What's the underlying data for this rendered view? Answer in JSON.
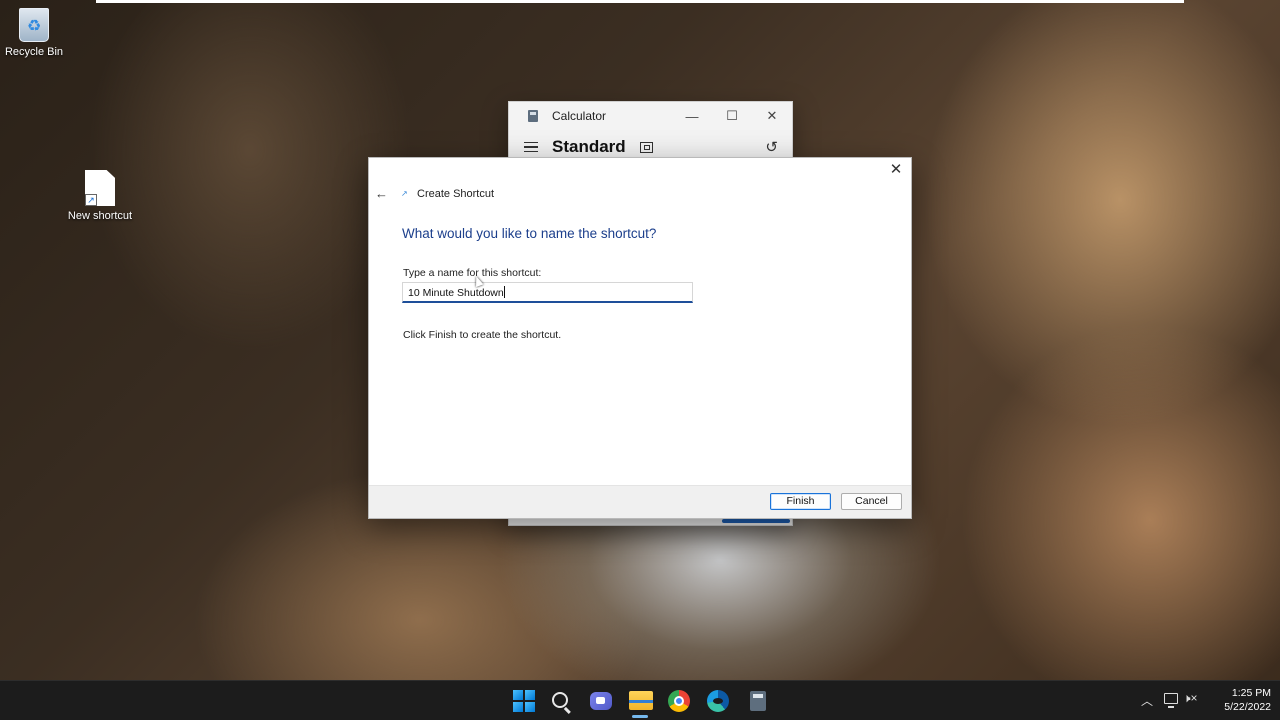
{
  "desktop": {
    "recycle_bin_label": "Recycle Bin",
    "new_shortcut_label": "New shortcut"
  },
  "calculator": {
    "title": "Calculator",
    "mode": "Standard",
    "minimize_glyph": "—",
    "maximize_glyph": "☐",
    "close_glyph": "✕"
  },
  "dialog": {
    "title": "Create Shortcut",
    "question": "What would you like to name the shortcut?",
    "name_label": "Type a name for this shortcut:",
    "name_value": "10 Minute Shutdown",
    "hint": "Click Finish to create the shortcut.",
    "finish_label": "Finish",
    "cancel_label": "Cancel",
    "close_glyph": "✕",
    "back_glyph": "←"
  },
  "taskbar": {
    "time": "1:25 PM",
    "date": "5/22/2022",
    "icons": [
      "start-icon",
      "search-icon",
      "chat-icon",
      "file-explorer-icon",
      "chrome-icon",
      "edge-icon",
      "calculator-icon"
    ],
    "tray_chevron": "︿",
    "volume_glyph": "🕨×"
  },
  "colors": {
    "accent": "#1e4f9a",
    "question_text": "#1c3f8c",
    "taskbar_bg": "#1c1c1c"
  }
}
